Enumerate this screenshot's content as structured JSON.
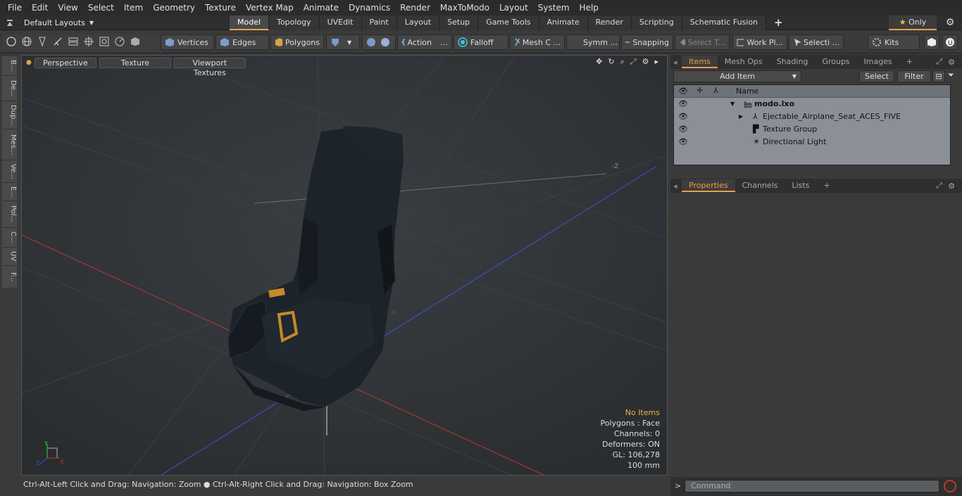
{
  "menu": [
    "File",
    "Edit",
    "View",
    "Select",
    "Item",
    "Geometry",
    "Texture",
    "Vertex Map",
    "Animate",
    "Dynamics",
    "Render",
    "MaxToModo",
    "Layout",
    "System",
    "Help"
  ],
  "layouts": {
    "label": "Default Layouts"
  },
  "mode_tabs": [
    "Model",
    "Topology",
    "UVEdit",
    "Paint",
    "Layout",
    "Setup",
    "Game Tools",
    "Animate",
    "Render",
    "Scripting",
    "Schematic Fusion"
  ],
  "only_label": "Only",
  "toolbar": {
    "vertices": "Vertices",
    "edges": "Edges",
    "polygons": "Polygons",
    "action": "Action",
    "falloff": "Falloff",
    "meshc": "Mesh C ...",
    "symm": "Symm ...",
    "snapping": "Snapping",
    "selectt": "Select T...",
    "workpl": "Work Pl...",
    "selecti": "Selecti ...",
    "kits": "Kits"
  },
  "left_tabs": [
    "B...",
    "De...",
    "Dup...",
    "Mes...",
    "Ve...",
    "E...",
    "Pol...",
    "C...",
    "UV",
    "F..."
  ],
  "viewport": {
    "perspective": "Perspective",
    "texture": "Texture",
    "viewport_textures": "Viewport Textures",
    "axis_label": "-Z"
  },
  "vp_info": {
    "no_items": "No Items",
    "polygons": "Polygons : Face",
    "channels": "Channels: 0",
    "deformers": "Deformers: ON",
    "gl": "GL: 106,278",
    "scale": "100 mm"
  },
  "status": "Ctrl-Alt-Left Click and Drag: Navigation: Zoom ● Ctrl-Alt-Right Click and Drag: Navigation: Box Zoom",
  "items_tabs": [
    "Items",
    "Mesh Ops",
    "Shading",
    "Groups",
    "Images"
  ],
  "items_panel": {
    "add_item": "Add Item",
    "select": "Select",
    "filter": "Filter",
    "name_col": "Name"
  },
  "items": [
    {
      "name": "modo.lxo"
    },
    {
      "name": "Ejectable_Airplane_Seat_ACES_FIVE"
    },
    {
      "name": "Texture Group"
    },
    {
      "name": "Directional Light"
    }
  ],
  "props_tabs": [
    "Properties",
    "Channels",
    "Lists"
  ],
  "command": {
    "placeholder": "Command",
    "prompt": ">"
  },
  "colors": {
    "accent": "#e8a04a",
    "axis_x": "#c0392b",
    "axis_y": "#2ecc40",
    "axis_z": "#3355cc"
  }
}
